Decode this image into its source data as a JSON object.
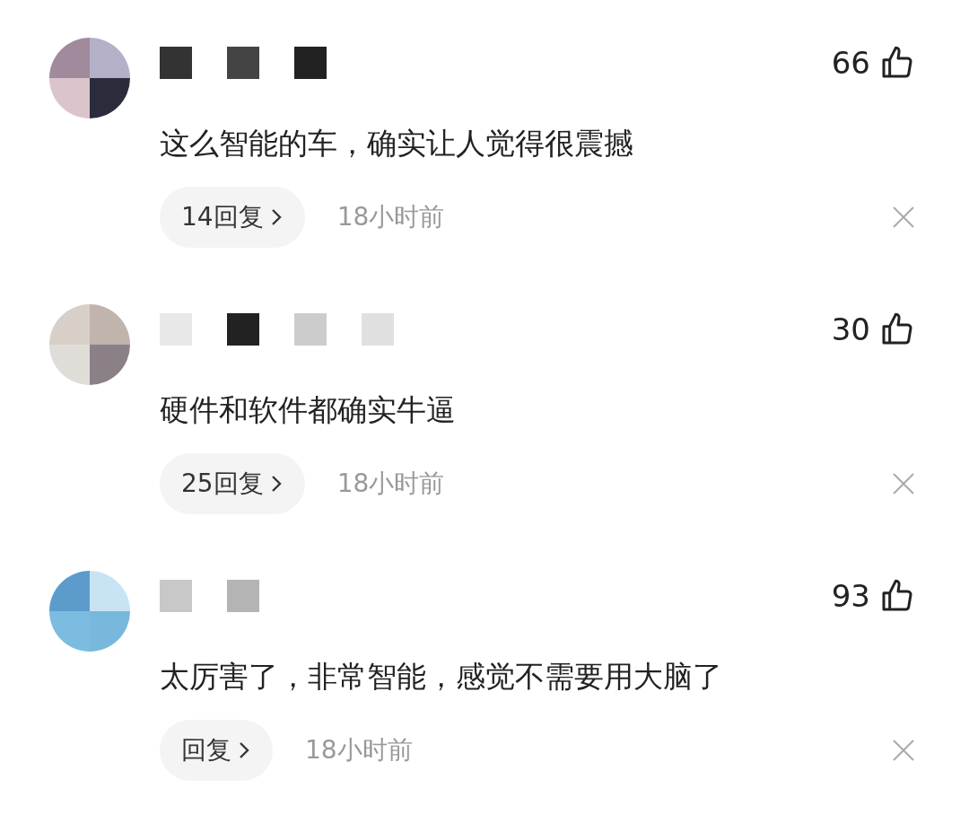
{
  "comments": [
    {
      "likes": "66",
      "text": "这么智能的车，确实让人觉得很震撼",
      "replies": "14回复",
      "time": "18小时前"
    },
    {
      "likes": "30",
      "text": "硬件和软件都确实牛逼",
      "replies": "25回复",
      "time": "18小时前"
    },
    {
      "likes": "93",
      "text": "太厉害了，非常智能，感觉不需要用大脑了",
      "replies": "回复",
      "time": "18小时前"
    }
  ]
}
